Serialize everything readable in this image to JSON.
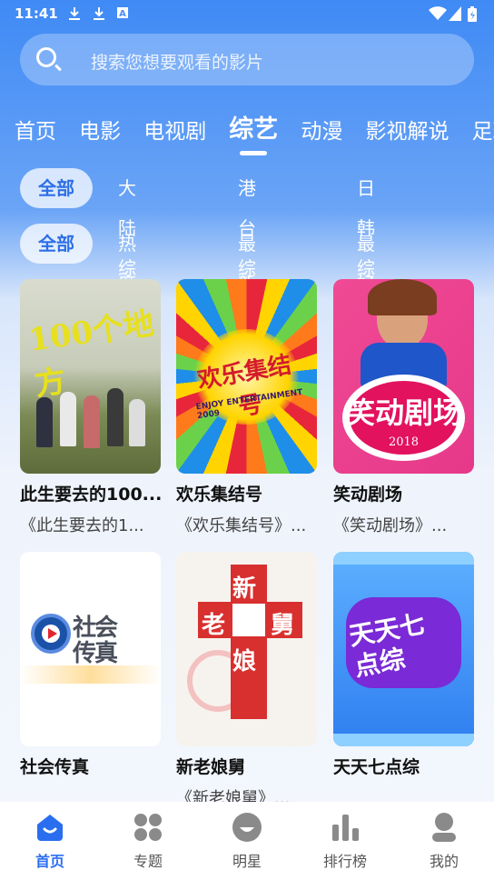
{
  "status_bar": {
    "time": "11:41"
  },
  "search": {
    "placeholder": "搜索您想要观看的影片"
  },
  "tabs": [
    {
      "label": "首页"
    },
    {
      "label": "电影"
    },
    {
      "label": "电视剧"
    },
    {
      "label": "综艺",
      "active": true
    },
    {
      "label": "动漫"
    },
    {
      "label": "影视解说"
    },
    {
      "label": "足球"
    }
  ],
  "region_filters": [
    "全部",
    "大陆综艺",
    "港台综艺",
    "日韩综艺"
  ],
  "sort_filters": [
    "全部",
    "热度最高",
    "最新上线",
    "最好评"
  ],
  "cards": [
    {
      "title": "此生要去的100...",
      "desc": "《此生要去的1...",
      "poster_text": "100个地方"
    },
    {
      "title": "欢乐集结号",
      "desc": "《欢乐集结号》...",
      "poster_text": "欢乐集结号",
      "poster_sub": "ENJOY ENTERTAINMENT 2009"
    },
    {
      "title": "笑动剧场",
      "desc": "《笑动剧场》...",
      "poster_text": "笑动剧场",
      "poster_sub": "2018"
    },
    {
      "title": "社会传真",
      "desc": "",
      "poster_text": "社会传真"
    },
    {
      "title": "新老娘舅",
      "desc": "《新老娘舅》...",
      "poster_text": [
        "新",
        "老",
        "舅",
        "娘"
      ]
    },
    {
      "title": "天天七点综",
      "desc": "",
      "poster_text": "天天七点综"
    }
  ],
  "bottom_nav": [
    {
      "label": "首页",
      "icon": "home-smile-icon",
      "active": true
    },
    {
      "label": "专题",
      "icon": "grid-icon"
    },
    {
      "label": "明星",
      "icon": "star-face-icon"
    },
    {
      "label": "排行榜",
      "icon": "bar-chart-icon"
    },
    {
      "label": "我的",
      "icon": "user-icon"
    }
  ],
  "colors": {
    "accent": "#2a6ef0",
    "top_gradient": "#3f8af5"
  }
}
